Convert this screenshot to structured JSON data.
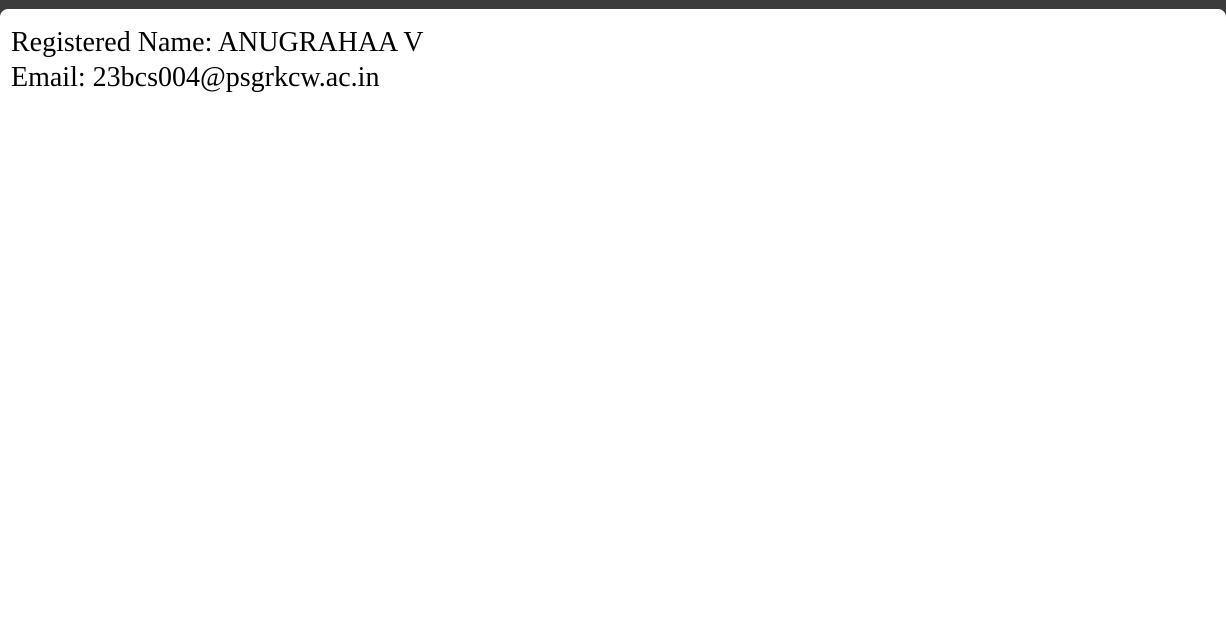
{
  "page": {
    "registered_name_line": "Registered Name: ANUGRAHAA V",
    "email_line": "Email: 23bcs004@psgrkcw.ac.in"
  },
  "colors": {
    "window_chrome": "#3b3b3b",
    "page_background": "#ffffff",
    "text": "#000000"
  }
}
